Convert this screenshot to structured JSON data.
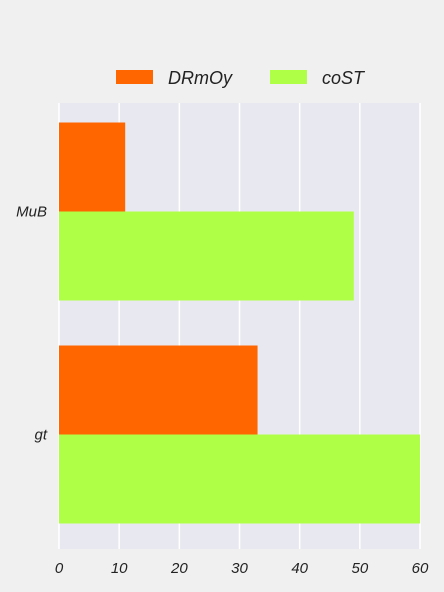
{
  "chart_data": {
    "type": "bar",
    "orientation": "horizontal",
    "categories": [
      "MuB",
      "gt"
    ],
    "series": [
      {
        "name": "DRmOy",
        "values": [
          11,
          33
        ],
        "color": "#ff6600"
      },
      {
        "name": "coST",
        "values": [
          49,
          60
        ],
        "color": "#b0ff47"
      }
    ],
    "xlim": [
      0,
      60
    ],
    "xticks": [
      0,
      10,
      20,
      30,
      40,
      50,
      60
    ],
    "grid": true,
    "legend_position": "top-center",
    "plot_background": "#e8e8f0",
    "page_background": "#f0f0f0"
  }
}
